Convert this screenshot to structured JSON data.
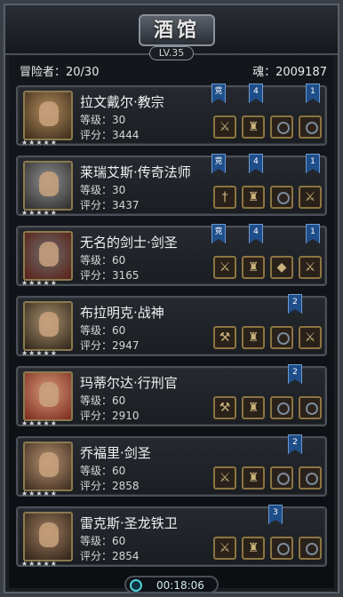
{
  "header": {
    "title": "酒馆",
    "level": "LV.35"
  },
  "stats": {
    "adventurers": "冒险者：20/30",
    "souls": "魂：2009187"
  },
  "heroes": [
    {
      "name": "拉文戴尔·教宗",
      "level": "等级：30",
      "score": "评分：3444",
      "flags": [
        {
          "label": "竞"
        },
        {
          "label": "4"
        },
        {
          "label": "1"
        }
      ]
    },
    {
      "name": "莱瑞艾斯·传奇法师",
      "level": "等级：30",
      "score": "评分：3437",
      "flags": [
        {
          "label": "竞"
        },
        {
          "label": "4"
        },
        {
          "label": "1"
        }
      ]
    },
    {
      "name": "无名的剑士·剑圣",
      "level": "等级：60",
      "score": "评分：3165",
      "flags": [
        {
          "label": "竞"
        },
        {
          "label": "4"
        },
        {
          "label": "1"
        }
      ]
    },
    {
      "name": "布拉明克·战神",
      "level": "等级：60",
      "score": "评分：2947",
      "flags": [
        {
          "label": "2"
        }
      ]
    },
    {
      "name": "玛蒂尔达·行刑官",
      "level": "等级：60",
      "score": "评分：2910",
      "flags": [
        {
          "label": "2"
        }
      ]
    },
    {
      "name": "乔福里·剑圣",
      "level": "等级：60",
      "score": "评分：2858",
      "flags": [
        {
          "label": "2"
        }
      ]
    },
    {
      "name": "雷克斯·圣龙铁卫",
      "level": "等级：60",
      "score": "评分：2854",
      "flags": [
        {
          "label": "3"
        }
      ]
    }
  ],
  "stars": "★★★★★",
  "timer": "00:18:06",
  "icons": {
    "equipment_slot": "equipment-slot-icon",
    "flag": "rank-flag-icon",
    "clock": "clock-icon"
  },
  "colors": {
    "accent_blue": "#1f4f8a",
    "gold_border": "#8c7442"
  }
}
